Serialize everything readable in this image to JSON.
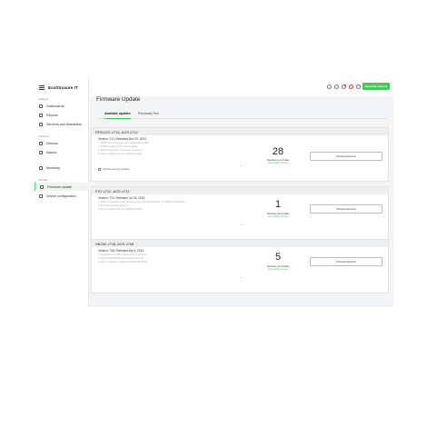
{
  "sidebar": {
    "brand": "EcoStruxure IT",
    "sections": [
      {
        "label": "Analysis"
      },
      {
        "label": "Inventory"
      },
      {
        "label": "Manage"
      }
    ],
    "items": [
      {
        "label": "Dashboards",
        "icon": "dashboard-icon"
      },
      {
        "label": "Reports",
        "icon": "report-icon"
      },
      {
        "label": "Services and Warranties",
        "icon": "shield-icon"
      },
      {
        "label": "Devices",
        "icon": "device-icon"
      },
      {
        "label": "Alarms",
        "icon": "bell-icon"
      },
      {
        "label": "Modeling",
        "icon": "cube-icon"
      },
      {
        "label": "Firmware update",
        "icon": "upload-icon",
        "active": true
      },
      {
        "label": "Device configuration",
        "icon": "settings-icon"
      }
    ]
  },
  "topbar": {
    "icons": [
      "search-icon",
      "help-icon",
      "notification-icon",
      "alert-icon",
      "user-icon"
    ],
    "brand_label": "Schneider Electric"
  },
  "page": {
    "title": "Firmware Update",
    "tabs": [
      {
        "label": "Available updates",
        "active": true
      },
      {
        "label": "Previously Run",
        "active": false
      }
    ]
  },
  "cards": [
    {
      "title": "RPDU2G v713, AOS v712",
      "version": "Version: 713, Released Dec 20, 2023",
      "notes": [
        "1. SNMP trap numbers are now configurable in traps",
        "2. HTTPS security is TLS 1.2 now added",
        "3. Web improvements to customer experience",
        "4. Refer to release notes for additional details"
      ],
      "checkbox_label": "Includes security updates",
      "count": "28",
      "count_label": "Devices out of date",
      "link": "View eligible devices",
      "button": "Choose Devices"
    },
    {
      "title": "PX2 v712, AOS v712",
      "version": "Version: 712, Released Jul 18, 2023",
      "notes": [
        "1. Adds a Temperature alert maximum level to the Data Interface (1.1 SNMP and Modbus)",
        "2. Bug fixes and improvements",
        "3. Refer to release notes for additional details"
      ],
      "count": "1",
      "count_label": "Devices out of date",
      "link": "View eligible devices",
      "button": "Choose Devices"
    },
    {
      "title": "NB250 v708, AOS v708",
      "version": "Version: 708, Released Apr 8, 2023",
      "notes": [
        "1. Added alarm for UPS module error on config file",
        "2. Implemented HTTPS strict transport Security",
        "3. Refer to ups doc for additional details (RN-9302)"
      ],
      "count": "5",
      "count_label": "Devices out of date",
      "link": "View eligible devices",
      "button": "Choose Devices"
    }
  ],
  "colors": {
    "accent": "#3dcd58",
    "alert": "#d9332f",
    "background": "#f3f4f5"
  }
}
